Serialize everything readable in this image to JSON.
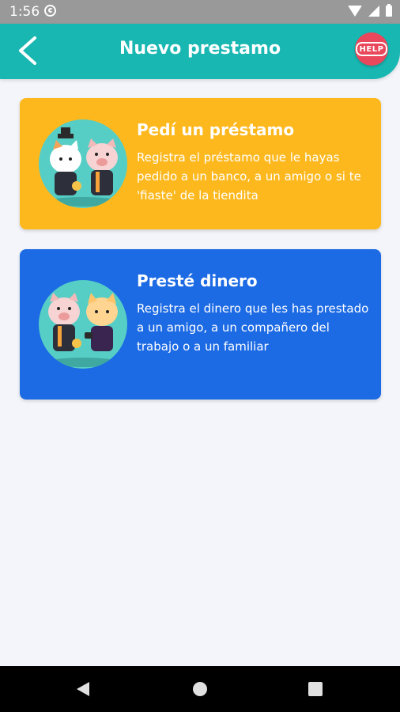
{
  "status": {
    "time": "1:56",
    "icons": [
      "sync-icon",
      "wifi-icon",
      "signal-icon",
      "battery-icon"
    ]
  },
  "appbar": {
    "title": "Nuevo prestamo",
    "back_icon": "chevron-left-icon",
    "help_label": "HELP",
    "color": "#19b7b2"
  },
  "cards": [
    {
      "title": "Pedí un préstamo",
      "description": "Registra el préstamo que le hayas pedido a un banco, a un amigo o si te 'fiaste' de la tiendita",
      "color": "#fdb81e",
      "illustration": "cat-and-pig-illustration"
    },
    {
      "title": "Presté dinero",
      "description": "Registra el dinero que les has prestado a un amigo, a un compañero del trabajo o a un familiar",
      "color": "#1c6ae4",
      "illustration": "pig-and-cat-illustration"
    }
  ],
  "navbar": {
    "icons": [
      "nav-back-icon",
      "nav-home-icon",
      "nav-recents-icon"
    ]
  }
}
